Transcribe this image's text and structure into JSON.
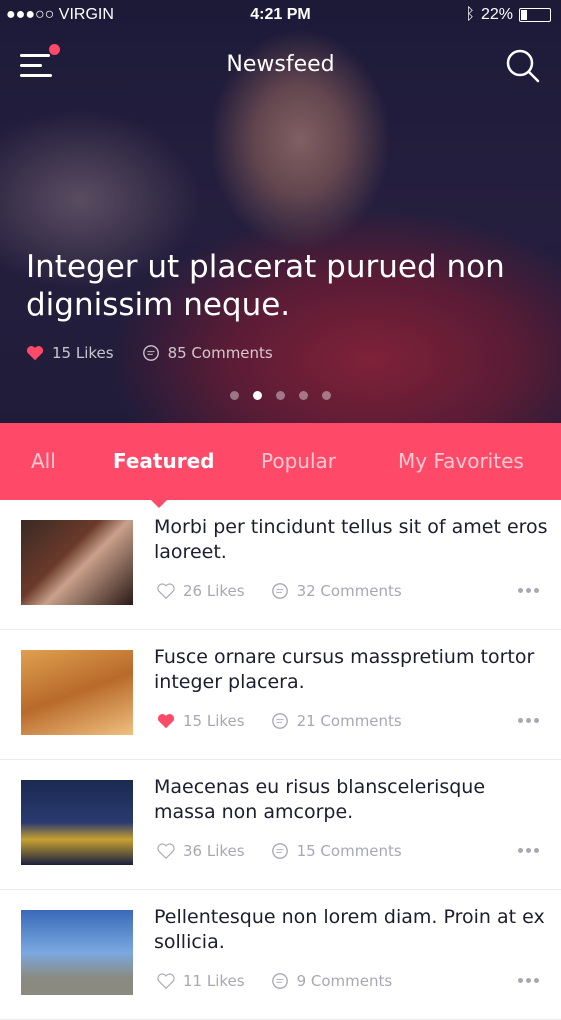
{
  "status": {
    "carrier": "●●●○○ VIRGIN",
    "time": "4:21 PM",
    "battery": "22%"
  },
  "header": {
    "title": "Newsfeed"
  },
  "hero": {
    "headline": "Integer ut placerat purued non dignissim neque.",
    "likes": "15 Likes",
    "comments": "85 Comments",
    "slides": 5,
    "active_slide": 2
  },
  "tabs": [
    {
      "label": "All"
    },
    {
      "label": "Featured"
    },
    {
      "label": "Popular"
    },
    {
      "label": "My Favorites"
    }
  ],
  "items": [
    {
      "title": "Morbi per tincidunt tellus sit of amet eros laoreet.",
      "likes": "26 Likes",
      "comments": "32 Comments",
      "liked": false
    },
    {
      "title": "Fusce ornare cursus masspretium tortor integer placera.",
      "likes": "15 Likes",
      "comments": "21 Comments",
      "liked": true
    },
    {
      "title": "Maecenas eu risus blanscelerisque massa non amcorpe.",
      "likes": "36 Likes",
      "comments": "15 Comments",
      "liked": false
    },
    {
      "title": "Pellentesque non lorem diam. Proin at ex sollicia.",
      "likes": "11 Likes",
      "comments": "9 Comments",
      "liked": false
    }
  ],
  "colors": {
    "accent": "#fe4a68"
  }
}
